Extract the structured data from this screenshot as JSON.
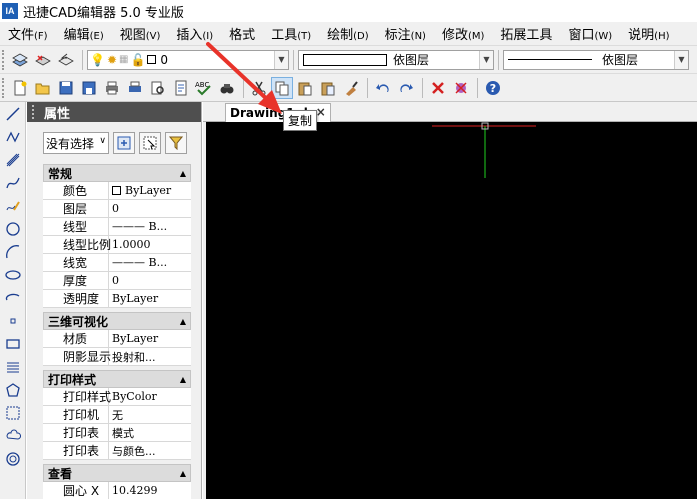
{
  "window": {
    "logo": "IA",
    "title": "迅捷CAD编辑器 5.0 专业版"
  },
  "menubar": {
    "items": [
      {
        "label": "文件",
        "key": "(F)"
      },
      {
        "label": "编辑",
        "key": "(E)"
      },
      {
        "label": "视图",
        "key": "(V)"
      },
      {
        "label": "插入",
        "key": "(I)"
      },
      {
        "label": "格式",
        "key": ""
      },
      {
        "label": "工具",
        "key": "(T)"
      },
      {
        "label": "绘制",
        "key": "(D)"
      },
      {
        "label": "标注",
        "key": "(N)"
      },
      {
        "label": "修改",
        "key": "(M)"
      },
      {
        "label": "拓展工具",
        "key": ""
      },
      {
        "label": "窗口",
        "key": "(W)"
      },
      {
        "label": "说明",
        "key": "(H)"
      }
    ]
  },
  "toolbar1": {
    "layer_value": "0",
    "color_value": "依图层",
    "linetype_value": "依图层"
  },
  "properties": {
    "title": "属性",
    "selection": "没有选择",
    "sections": [
      {
        "title": "常规",
        "rows": [
          {
            "name": "颜色",
            "value": "ByLayer"
          },
          {
            "name": "图层",
            "value": "0"
          },
          {
            "name": "线型",
            "value": "——— B..."
          },
          {
            "name": "线型比例",
            "value": "1.0000"
          },
          {
            "name": "线宽",
            "value": "——— B..."
          },
          {
            "name": "厚度",
            "value": "0"
          },
          {
            "name": "透明度",
            "value": "ByLayer"
          }
        ]
      },
      {
        "title": "三维可视化",
        "rows": [
          {
            "name": "材质",
            "value": "ByLayer"
          },
          {
            "name": "阴影显示",
            "value": "投射和..."
          }
        ]
      },
      {
        "title": "打印样式",
        "rows": [
          {
            "name": "打印样式",
            "value": "ByColor"
          },
          {
            "name": "打印机",
            "value": "无"
          },
          {
            "name": "打印表",
            "value": "模式"
          },
          {
            "name": "打印表",
            "value": "与颜色..."
          }
        ]
      },
      {
        "title": "查看",
        "rows": [
          {
            "name": "圆心 X",
            "value": "10.4299"
          }
        ]
      }
    ]
  },
  "drawing_tab": {
    "label": "Drawing1.d"
  },
  "tooltip": {
    "text": "复制"
  },
  "colors": {
    "canvas": "#000000",
    "crosshair_x": "#e02020",
    "crosshair_y": "#20d020",
    "arrow": "#e8332a"
  }
}
